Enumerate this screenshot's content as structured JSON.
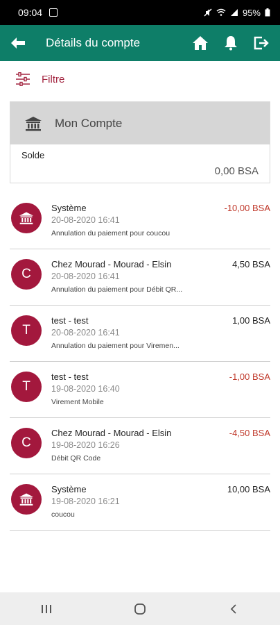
{
  "status_bar": {
    "time": "09:04",
    "battery": "95%"
  },
  "app_bar": {
    "title": "Détails du compte"
  },
  "filter": {
    "label": "Filtre"
  },
  "account": {
    "name": "Mon Compte",
    "balance_label": "Solde",
    "balance_value": "0,00 BSA"
  },
  "transactions": [
    {
      "avatar": "bank",
      "name": "Système",
      "date": "20-08-2020 16:41",
      "description": "Annulation du paiement pour coucou",
      "amount": "-10,00 BSA",
      "negative": true
    },
    {
      "avatar": "C",
      "name": "Chez Mourad - Mourad - Elsin",
      "date": "20-08-2020 16:41",
      "description": "Annulation du paiement pour Débit QR...",
      "amount": "4,50 BSA",
      "negative": false
    },
    {
      "avatar": "T",
      "name": "test - test",
      "date": "20-08-2020 16:41",
      "description": "Annulation du paiement pour Viremen...",
      "amount": "1,00 BSA",
      "negative": false
    },
    {
      "avatar": "T",
      "name": "test - test",
      "date": "19-08-2020 16:40",
      "description": "Virement Mobile",
      "amount": "-1,00 BSA",
      "negative": true
    },
    {
      "avatar": "C",
      "name": "Chez Mourad - Mourad - Elsin",
      "date": "19-08-2020 16:26",
      "description": "Débit QR Code",
      "amount": "-4,50 BSA",
      "negative": true
    },
    {
      "avatar": "bank",
      "name": "Système",
      "date": "19-08-2020 16:21",
      "description": "coucou",
      "amount": "10,00 BSA",
      "negative": false
    }
  ],
  "colors": {
    "app_bar": "#0e7e68",
    "accent": "#a32540",
    "avatar": "#a3183d",
    "negative_amount": "#c0392b"
  }
}
